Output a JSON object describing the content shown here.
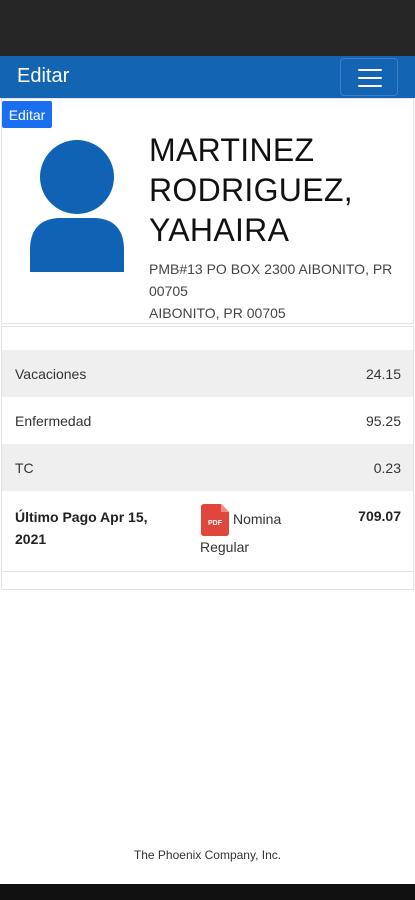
{
  "header": {
    "title": "Editar"
  },
  "profile": {
    "edit_label": "Editar",
    "name_lines": [
      "MARTINEZ",
      "RODRIGUEZ,",
      "YAHAIRA"
    ],
    "address_lines": [
      "PMB#13 PO BOX 2300 AIBONITO, PR",
      "00705",
      "AIBONITO, PR 00705"
    ]
  },
  "balances": [
    {
      "label": "Vacaciones",
      "value": "24.15"
    },
    {
      "label": "Enfermedad",
      "value": "95.25"
    },
    {
      "label": "TC",
      "value": "0.23"
    }
  ],
  "last_payment": {
    "label_line1": "Último Pago Apr 15,",
    "label_line2": "2021",
    "pdf_icon_text": "PDF",
    "doc_line1": "Nomina",
    "doc_line2": "Regular",
    "amount": "709.07"
  },
  "footer": {
    "text": "The Phoenix Company, Inc."
  },
  "colors": {
    "header": "#1464b4",
    "edit_button": "#1a6ff0",
    "avatar": "#0f62b4",
    "pdf_icon": "#e0463c"
  }
}
